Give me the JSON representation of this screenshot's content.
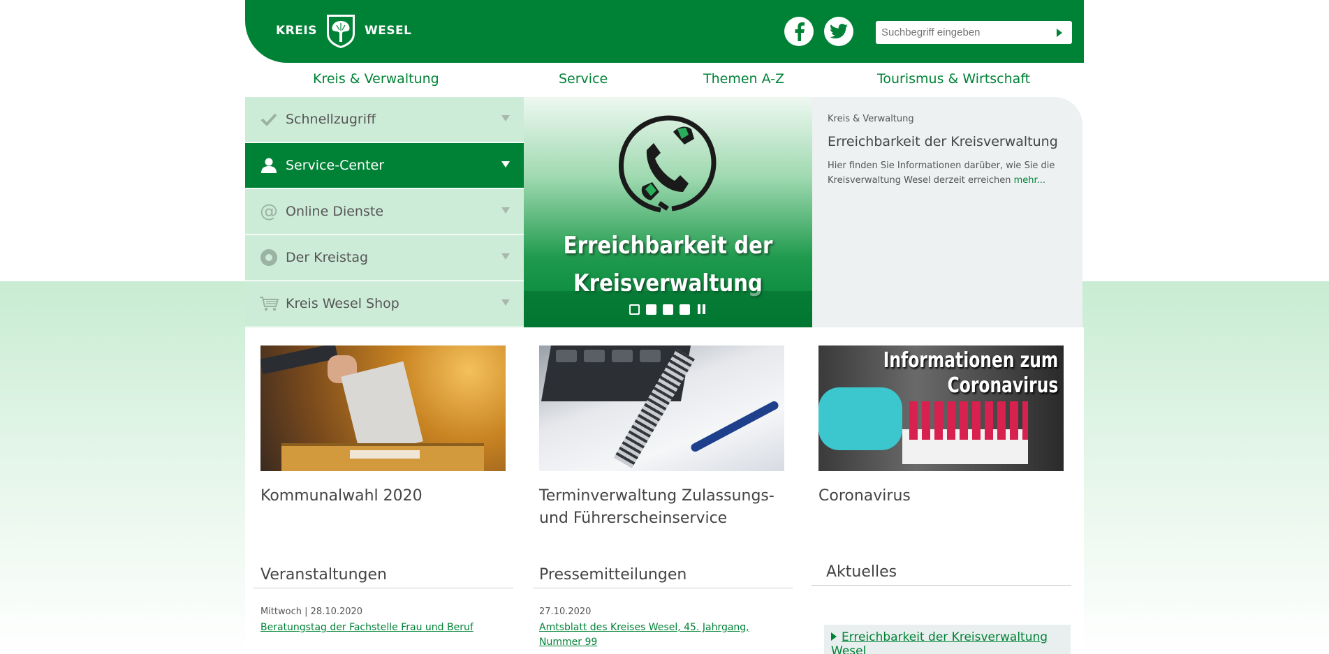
{
  "header": {
    "logo_left": "KREIS",
    "logo_right": "WESEL",
    "search_placeholder": "Suchbegriff eingeben",
    "colors": {
      "brand": "#008236",
      "menu_bg": "#cdecd7",
      "teaser_bg": "#edf1f1"
    }
  },
  "nav": {
    "items": [
      {
        "label": "Kreis & Verwaltung"
      },
      {
        "label": "Service"
      },
      {
        "label": "Themen A-Z"
      },
      {
        "label": "Tourismus & Wirtschaft"
      }
    ]
  },
  "menu": {
    "items": [
      {
        "label": "Schnellzugriff",
        "icon": "checkmark-icon"
      },
      {
        "label": "Service-Center",
        "icon": "person-icon",
        "active": true
      },
      {
        "label": "Online Dienste",
        "icon": "at-sign-icon"
      },
      {
        "label": "Der Kreistag",
        "icon": "circle-icon"
      },
      {
        "label": "Kreis Wesel Shop",
        "icon": "cart-icon"
      }
    ]
  },
  "slider": {
    "caption_line1": "Erreichbarkeit der",
    "caption_line2": "Kreisverwaltung",
    "slide_count": 4,
    "current_slide": 1
  },
  "teaser": {
    "category": "Kreis & Verwaltung",
    "title": "Erreichbarkeit der Kreisverwaltung",
    "text": "Hier finden Sie Informationen darüber, wie Sie die Kreisverwaltung Wesel derzeit erreichen ",
    "more": "mehr..."
  },
  "cards": [
    {
      "title": "Kommunalwahl 2020"
    },
    {
      "title": "Terminverwaltung Zulassungs- und Führerscheinservice"
    },
    {
      "title": "Coronavirus",
      "overlay_line1": "Informationen zum",
      "overlay_line2": "Coronavirus"
    }
  ],
  "sections": {
    "events": {
      "title": "Veranstaltungen",
      "meta": "Mittwoch | 28.10.2020",
      "link": "Beratungstag der Fachstelle Frau und Beruf"
    },
    "press": {
      "title": "Pressemitteilungen",
      "meta": "27.10.2020",
      "link": "Amtsblatt des Kreises Wesel, 45. Jahrgang, Nummer 99"
    },
    "news": {
      "title": "Aktuelles",
      "link": "Erreichbarkeit der Kreisverwaltung Wesel"
    }
  }
}
